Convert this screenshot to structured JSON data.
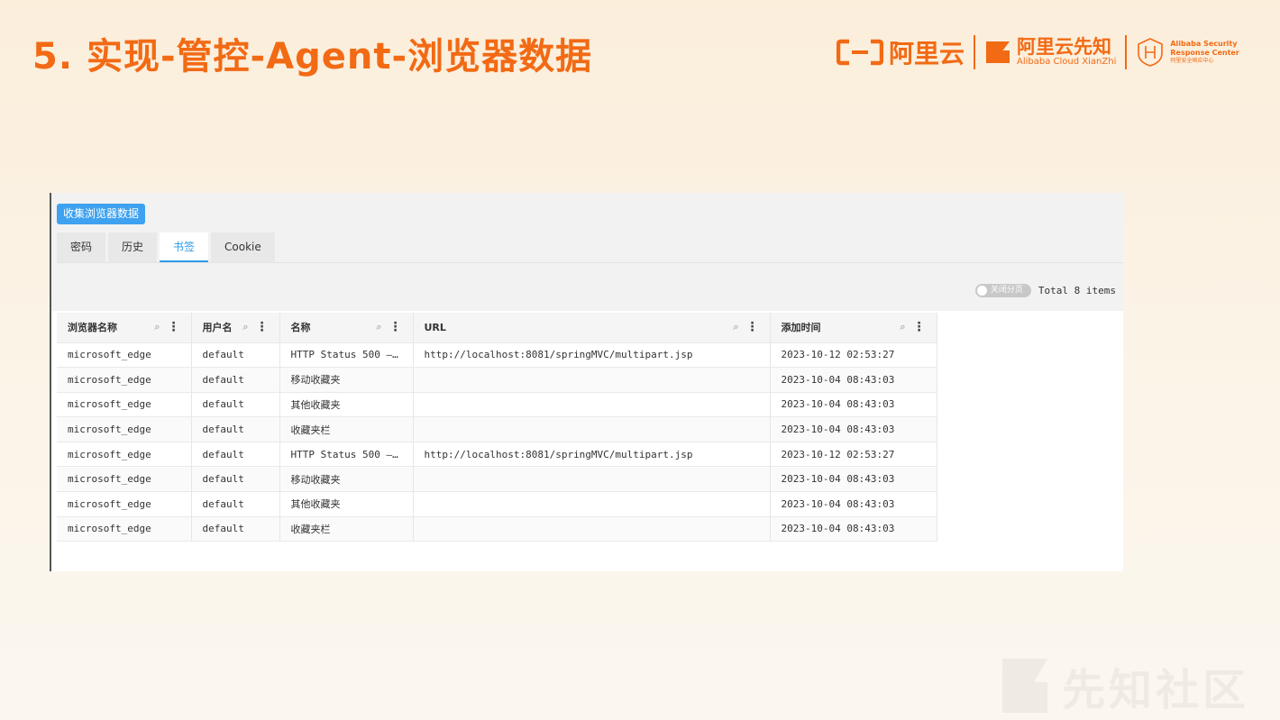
{
  "slide": {
    "title": "5. 实现-管控-Agent-浏览器数据"
  },
  "logos": {
    "aliyun": "阿里云",
    "xianzhi_cn": "阿里云先知",
    "xianzhi_en": "Alibaba Cloud XianZhi",
    "asrc_en_1": "Alibaba Security",
    "asrc_en_2": "Response Center",
    "asrc_cn": "阿里安全响应中心",
    "brand_color": "#f26a14"
  },
  "watermark": {
    "text": "先知社区"
  },
  "panel": {
    "collect_button": "收集浏览器数据",
    "tabs": [
      {
        "label": "密码",
        "active": false
      },
      {
        "label": "历史",
        "active": false
      },
      {
        "label": "书签",
        "active": true
      },
      {
        "label": "Cookie",
        "active": false
      }
    ],
    "pagination_switch": "关闭分页",
    "total": "Total 8 items",
    "accent_color": "#3ea2f0"
  },
  "table": {
    "columns": [
      "浏览器名称",
      "用户名",
      "名称",
      "URL",
      "添加时间"
    ],
    "rows": [
      [
        "microsoft_edge",
        "default",
        "HTTP Status 500 – …",
        "http://localhost:8081/springMVC/multipart.jsp",
        "2023-10-12 02:53:27"
      ],
      [
        "microsoft_edge",
        "default",
        "移动收藏夹",
        "",
        "2023-10-04 08:43:03"
      ],
      [
        "microsoft_edge",
        "default",
        "其他收藏夹",
        "",
        "2023-10-04 08:43:03"
      ],
      [
        "microsoft_edge",
        "default",
        "收藏夹栏",
        "",
        "2023-10-04 08:43:03"
      ],
      [
        "microsoft_edge",
        "default",
        "HTTP Status 500 – …",
        "http://localhost:8081/springMVC/multipart.jsp",
        "2023-10-12 02:53:27"
      ],
      [
        "microsoft_edge",
        "default",
        "移动收藏夹",
        "",
        "2023-10-04 08:43:03"
      ],
      [
        "microsoft_edge",
        "default",
        "其他收藏夹",
        "",
        "2023-10-04 08:43:03"
      ],
      [
        "microsoft_edge",
        "default",
        "收藏夹栏",
        "",
        "2023-10-04 08:43:03"
      ]
    ]
  }
}
